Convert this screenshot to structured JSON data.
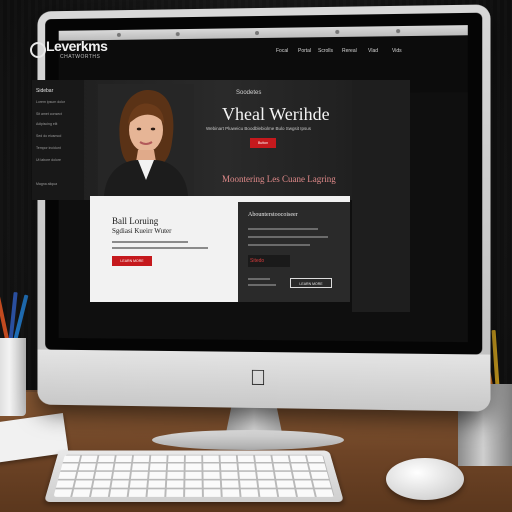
{
  "site": {
    "brand": "Leverkms",
    "brand_sub": "CHATWORTHS",
    "nav": [
      "Focal",
      "Portal",
      "Scrolls",
      "Rereal",
      "Vlad",
      "Vids"
    ]
  },
  "sidebar": {
    "title": "Sidebar",
    "lines": [
      "Lorem ipsum dolor",
      "Sit amet consect",
      "Adipiscing elit",
      "Sed do eiusmod",
      "Tempor incidunt",
      "Ut labore dolore",
      "Magna aliqua"
    ]
  },
  "hero": {
    "kicker": "Soodetes",
    "title": "Vheal Werihde",
    "subtitle": "Webinart Pluweicu Boodblebiolme Bulo Swgsit Ipsus",
    "button": "Button",
    "tagline": "Moontering Les Cuane Lagring"
  },
  "card_left": {
    "title": "Ball Loruing",
    "subtitle": "Sgdiasi Kueirr Wuter",
    "button": "LEARN MORE"
  },
  "card_right": {
    "title": "Abounterstoocoiseer",
    "tag": "Sitedo",
    "button": "LEARN MORE"
  },
  "icons": {
    "apple": "apple-logo-icon",
    "brand": "brand-logo-icon"
  },
  "colors": {
    "accent": "#c5191d"
  }
}
